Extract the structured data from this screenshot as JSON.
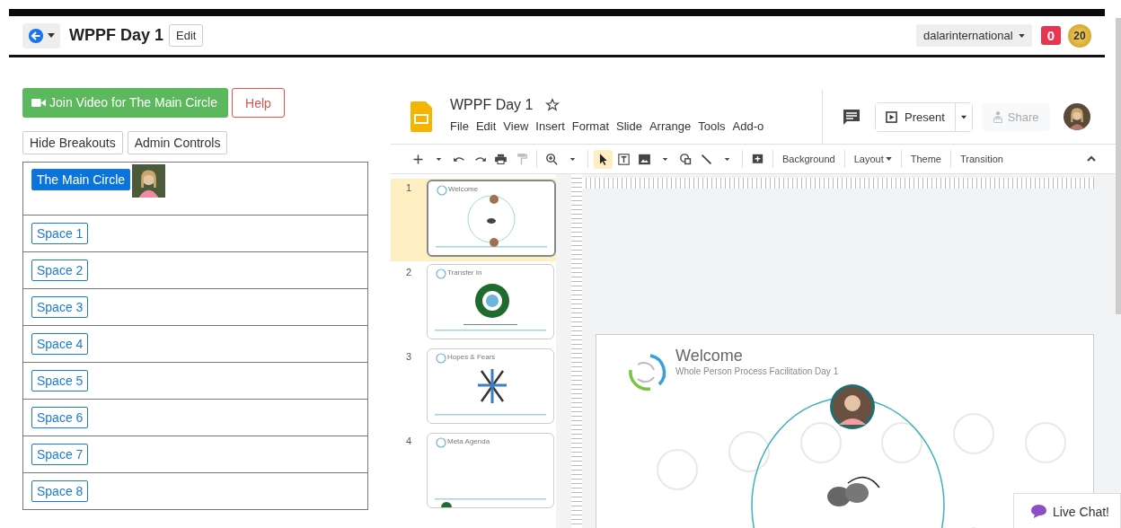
{
  "header": {
    "title": "WPPF Day 1",
    "edit_button": "Edit",
    "user_menu": "dalarinternational",
    "notification_count": "0",
    "points": "20"
  },
  "left_panel": {
    "join_button": "Join Video for The Main Circle",
    "help_button": "Help",
    "buttons": [
      "Hide Breakouts",
      "Admin Controls"
    ],
    "rooms": [
      {
        "label": "The Main Circle",
        "selected": true
      },
      {
        "label": "Space 1",
        "selected": false
      },
      {
        "label": "Space 2",
        "selected": false
      },
      {
        "label": "Space 3",
        "selected": false
      },
      {
        "label": "Space 4",
        "selected": false
      },
      {
        "label": "Space 5",
        "selected": false
      },
      {
        "label": "Space 6",
        "selected": false
      },
      {
        "label": "Space 7",
        "selected": false
      },
      {
        "label": "Space 8",
        "selected": false
      }
    ]
  },
  "slides": {
    "doc_title": "WPPF Day 1",
    "starred": false,
    "menu": [
      "File",
      "Edit",
      "View",
      "Insert",
      "Format",
      "Slide",
      "Arrange",
      "Tools",
      "Add-o"
    ],
    "present_button": "Present",
    "share_button": {
      "label": "Share",
      "disabled": true
    },
    "toolbar": [
      "Background",
      "Layout",
      "Theme",
      "Transition"
    ],
    "thumbnails": [
      {
        "number": "1",
        "title": "Welcome",
        "selected": true,
        "kind": "welcome"
      },
      {
        "number": "2",
        "title": "Transfer In",
        "selected": false,
        "kind": "ring"
      },
      {
        "number": "3",
        "title": "Hopes & Fears",
        "selected": false,
        "kind": "burst"
      },
      {
        "number": "4",
        "title": "Meta Agenda",
        "selected": false,
        "kind": "blank"
      }
    ],
    "slide": {
      "title": "Welcome",
      "subtitle": "Whole Person Process Facilitation Day 1"
    }
  },
  "live_chat": "Live Chat!"
}
